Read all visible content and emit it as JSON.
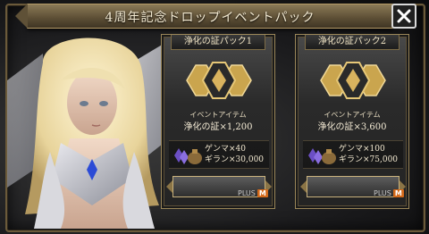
{
  "dialog": {
    "title": "4周年記念ドロップイベントパック",
    "close_icon": "close-icon"
  },
  "packs": [
    {
      "name": "浄化の証パック1",
      "event_label": "イベントアイテム",
      "reward": "浄化の証×1,200",
      "bonus_lines": [
        "ゲンマ×40",
        "ギラン×30,000"
      ],
      "badge_prefix": "PLUS",
      "badge": "M"
    },
    {
      "name": "浄化の証パック2",
      "event_label": "イベントアイテム",
      "reward": "浄化の証×3,600",
      "bonus_lines": [
        "ゲンマ×100",
        "ギラン×75,000"
      ],
      "badge_prefix": "PLUS",
      "badge": "M"
    }
  ],
  "colors": {
    "gold": "#c9a44f",
    "frame": "#6b5a3a",
    "badge": "#d46a1a"
  }
}
